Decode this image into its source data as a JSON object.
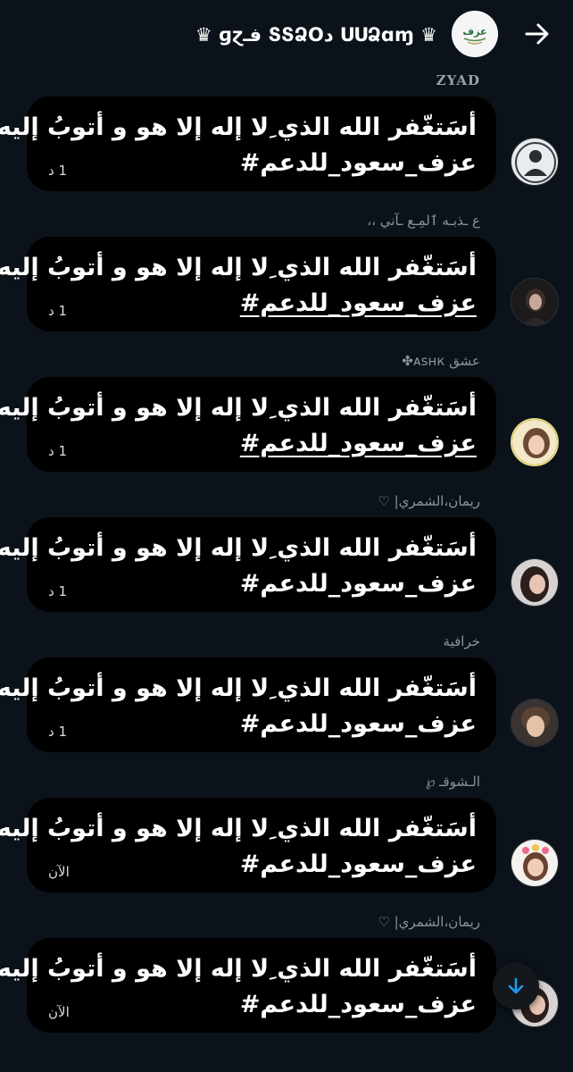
{
  "header": {
    "title": "♛ ɡɀفـ ՏՏՁOد ՍՍՁɑɱ ♛",
    "back_icon": "arrow-right-icon",
    "group_avatar_text": "عزف"
  },
  "messages": [
    {
      "sender": "ZYAD",
      "text": "أسَتغّفر الله الذي ِلا إله إلا هو و أتوبُ إليه .🌿.",
      "hashtag": "عزف_سعود_للدعم#",
      "time": "1 د",
      "hashtag_link": false
    },
    {
      "sender": "ع ـذبـه ٱلمِـع ـآني ،،",
      "text": "أسَتغّفر الله الذي ِلا إله إلا هو و أتوبُ إليه .🌿.",
      "hashtag": "عزف_سعود_للدعم#",
      "time": "1 د",
      "hashtag_link": true
    },
    {
      "sender": "عشق ᴀѕнк✤",
      "text": "أسَتغّفر الله الذي ِلا إله إلا هو و أتوبُ إليه .🌿.",
      "hashtag": "عزف_سعود_للدعم#",
      "time": "1 د",
      "hashtag_link": true
    },
    {
      "sender": "ريمان،الشمري| ♡",
      "text": "أسَتغّفر الله الذي ِلا إله إلا هو و أتوبُ إليه .🌿.",
      "hashtag": "عزف_سعود_للدعم#",
      "time": "1 د",
      "hashtag_link": false
    },
    {
      "sender": "خرافية",
      "text": "أسَتغّفر الله الذي ِلا إله إلا هو و أتوبُ إليه .🌿.",
      "hashtag": "عزف_سعود_للدعم#",
      "time": "1 د",
      "hashtag_link": false
    },
    {
      "sender": "الـشوقـ ℘",
      "text": "أسَتغّفر الله الذي ِلا إله إلا هو و أتوبُ إليه .🌿.",
      "hashtag": "عزف_سعود_للدعم#",
      "time": "الآن",
      "hashtag_link": false
    },
    {
      "sender": "ريمان،الشمري| ♡",
      "text": "أسَتغّفر الله الذي ِلا إله إلا هو و أتوبُ إليه .🌿.",
      "hashtag": "عزف_سعود_للدعم#",
      "time": "الآن",
      "hashtag_link": false
    }
  ],
  "scroll_button_icon": "arrow-down-icon",
  "colors": {
    "background": "#0b121a",
    "bubble": "#000000",
    "accent": "#1d9bf0",
    "muted": "#8c939b"
  }
}
